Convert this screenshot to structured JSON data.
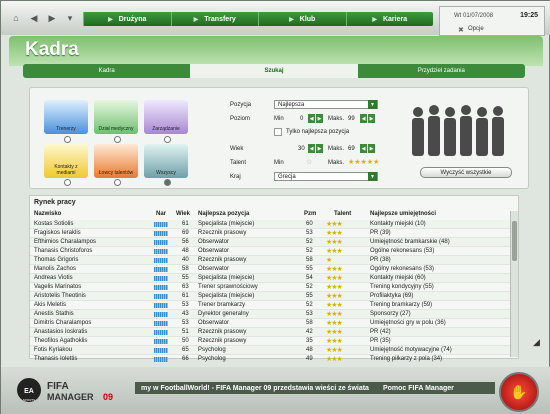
{
  "top": {
    "menu": [
      "Drużyna",
      "Transfery",
      "Klub",
      "Kariera"
    ],
    "date": "Wt 01/07/2008",
    "time": "19:25",
    "options": "Opcje"
  },
  "page_title": "Kadra",
  "tabs": [
    "Kadra",
    "Szukaj",
    "Przydziel zadania"
  ],
  "categories": [
    {
      "label": "Trenerzy",
      "color": "#4a90d9"
    },
    {
      "label": "Dział medyczny",
      "color": "#6fbf6f"
    },
    {
      "label": "Zarządzanie",
      "color": "#a788d0"
    },
    {
      "label": "Kontakty z mediami",
      "color": "#f0c830"
    },
    {
      "label": "Łowcy talentów",
      "color": "#e87a30"
    },
    {
      "label": "Wszyscy",
      "color": "#6fa0a8"
    }
  ],
  "filters": {
    "pozycja_label": "Pozycja",
    "pozycja_value": "Najlepsza",
    "poziom_label": "Poziom",
    "poziom_min_label": "Min",
    "poziom_min": "0",
    "poziom_max_label": "Maks.",
    "poziom_max": "99",
    "best_only": "Tylko najlepsza pozycja",
    "wiek_label": "Wiek",
    "wiek_min": "30",
    "wiek_max_label": "Maks.",
    "wiek_max": "69",
    "talent_label": "Talent",
    "talent_min_label": "Min",
    "talent_max_label": "Maks.",
    "kraj_label": "Kraj",
    "kraj_value": "Grecja"
  },
  "search_button": "Wyczyść wszystkie",
  "table": {
    "title": "Rynek pracy",
    "headers": {
      "name": "Nazwisko",
      "nar": "Nar",
      "age": "Wiek",
      "pos": "Najlepsza pozycja",
      "pzm": "Pzm",
      "talent": "Talent",
      "skill": "Najlepsze umiejętności"
    },
    "rows": [
      {
        "name": "Kostas Sotiolis",
        "age": "61",
        "pos": "Specjalista (miejscie)",
        "pzm": "60",
        "stars": 3,
        "skill": "Kontakty miejski (10)"
      },
      {
        "name": "Fragiskos Ieraklis",
        "age": "69",
        "pos": "Rzecznik prasowy",
        "pzm": "53",
        "stars": 3,
        "skill": "PR (39)"
      },
      {
        "name": "Efthimios Charalampos",
        "age": "56",
        "pos": "Obserwator",
        "pzm": "52",
        "stars": 3,
        "skill": "Umiejętność bramkarskie (48)"
      },
      {
        "name": "Thanasis Christoforos",
        "age": "48",
        "pos": "Obserwator",
        "pzm": "52",
        "stars": 3,
        "skill": "Ogólne rekonesans (53)"
      },
      {
        "name": "Thomas Grigoris",
        "age": "40",
        "pos": "Rzecznik prasowy",
        "pzm": "58",
        "stars": 1,
        "skill": "PR (38)"
      },
      {
        "name": "Manolis Zachos",
        "age": "58",
        "pos": "Obserwator",
        "pzm": "55",
        "stars": 3,
        "skill": "Ogólny rekonesans (53)"
      },
      {
        "name": "Andreas Viotis",
        "age": "55",
        "pos": "Specjalista (miejscie)",
        "pzm": "54",
        "stars": 3,
        "skill": "Kontakty miejski (60)"
      },
      {
        "name": "Vagelis Marinatos",
        "age": "63",
        "pos": "Trener sprawnościowy",
        "pzm": "52",
        "stars": 3,
        "skill": "Trening kondycyjny (55)"
      },
      {
        "name": "Aristotelis Theotinis",
        "age": "61",
        "pos": "Specjalista (miejscie)",
        "pzm": "55",
        "stars": 3,
        "skill": "Profilaktyka (69)"
      },
      {
        "name": "Akis Meletis",
        "age": "53",
        "pos": "Trener bramkarzy",
        "pzm": "52",
        "stars": 3,
        "skill": "Trening bramkarzy (59)"
      },
      {
        "name": "Anestis Stathis",
        "age": "43",
        "pos": "Dyrektor generalny",
        "pzm": "53",
        "stars": 3,
        "skill": "Sponsorzy (27)"
      },
      {
        "name": "Dimitris Charalampos",
        "age": "53",
        "pos": "Obserwator",
        "pzm": "58",
        "stars": 3,
        "skill": "Umiejętności gry w polu (36)"
      },
      {
        "name": "Anastasios Ioskratis",
        "age": "51",
        "pos": "Rzecznik prasowy",
        "pzm": "42",
        "stars": 3,
        "skill": "PR (42)"
      },
      {
        "name": "Theofilos Agathoklis",
        "age": "50",
        "pos": "Rzecznik prasowy",
        "pzm": "35",
        "stars": 3,
        "skill": "PR (35)"
      },
      {
        "name": "Fotis Kyriakou",
        "age": "65",
        "pos": "Psycholog",
        "pzm": "48",
        "stars": 3,
        "skill": "Umiejętność motywacyjne (74)"
      },
      {
        "name": "Thanasis Iolettis",
        "age": "66",
        "pos": "Psycholog",
        "pzm": "49",
        "stars": 3,
        "skill": "Trening piłkarzy z pola (34)"
      }
    ]
  },
  "ticker": "my w FootballWorld! - FIFA Manager 09 przedstawia wieści ze świata",
  "ticker_right": "Pomoc FIFA Manager",
  "logo": {
    "brand": "EA SPORTS",
    "product": "FIFA",
    "sub": "MANAGER09"
  }
}
